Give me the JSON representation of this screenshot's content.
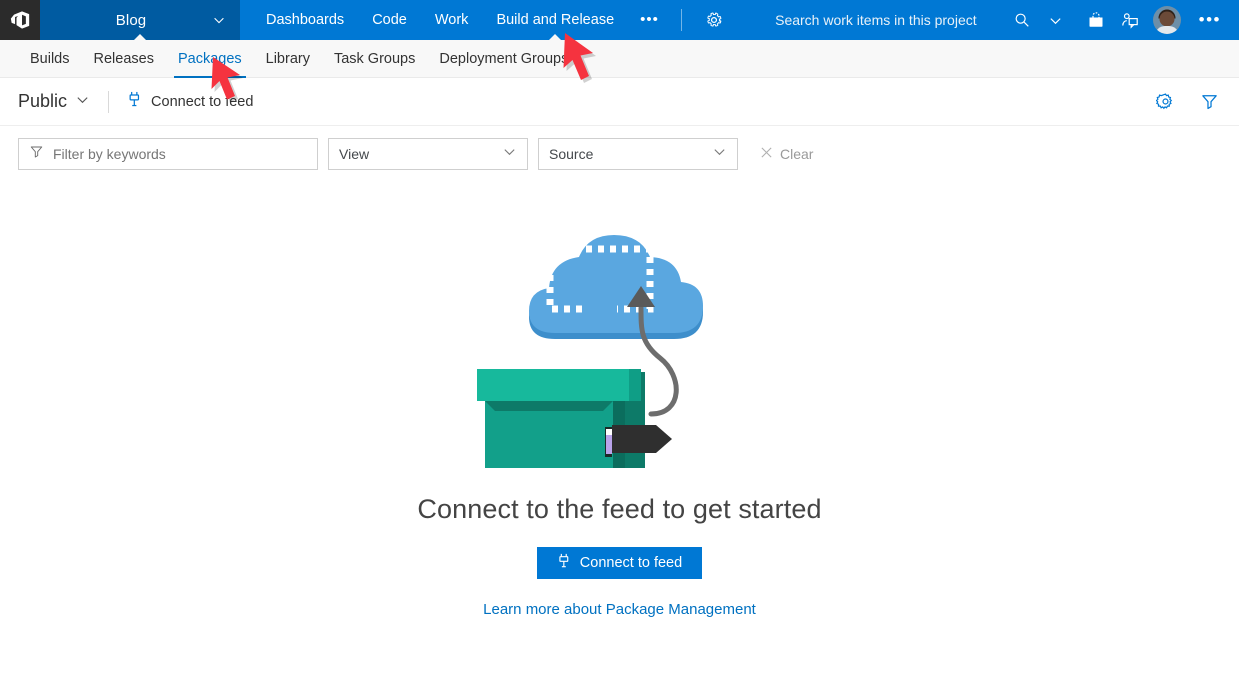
{
  "header": {
    "logo_icon": "azure-devops-logo-icon",
    "project_name": "Blog",
    "project_chevron_icon": "chevron-down-icon",
    "nav_items": [
      {
        "label": "Dashboards",
        "active": false
      },
      {
        "label": "Code",
        "active": false
      },
      {
        "label": "Work",
        "active": false
      },
      {
        "label": "Build and Release",
        "active": true
      }
    ],
    "overflow_label": "•••",
    "settings_icon": "gear-icon",
    "search_placeholder": "Search work items in this project",
    "search_icon": "search-icon",
    "search_chevron_icon": "chevron-down-icon",
    "marketplace_icon": "shopping-bag-icon",
    "help_icon": "user-feedback-icon",
    "avatar_icon": "avatar",
    "more_label": "•••"
  },
  "subnav": {
    "items": [
      {
        "label": "Builds",
        "active": false
      },
      {
        "label": "Releases",
        "active": false
      },
      {
        "label": "Packages",
        "active": true
      },
      {
        "label": "Library",
        "active": false
      },
      {
        "label": "Task Groups",
        "active": false
      },
      {
        "label": "Deployment Groups*",
        "active": false
      }
    ]
  },
  "feed_toolbar": {
    "feed_name": "Public",
    "feed_chevron_icon": "chevron-down-icon",
    "connect_label": "Connect to feed",
    "connect_icon": "plug-icon",
    "settings_icon": "gear-icon",
    "filter_icon": "funnel-icon"
  },
  "filters": {
    "keyword_placeholder": "Filter by keywords",
    "keyword_value": "",
    "keyword_icon": "funnel-icon",
    "view_label": "View",
    "view_options": [
      "View"
    ],
    "source_label": "Source",
    "source_options": [
      "Source"
    ],
    "clear_label": "Clear",
    "clear_icon": "close-icon",
    "dropdown_icon": "chevron-down-icon"
  },
  "empty_state": {
    "illustration_name": "cloud-upload-package-illustration",
    "title": "Connect to the feed to get started",
    "button_label": "Connect to feed",
    "button_icon": "plug-icon",
    "link_label": "Learn more about Package Management"
  },
  "annotations": [
    {
      "name": "red-arrow-build-and-release",
      "color": "#f5333f"
    },
    {
      "name": "red-arrow-packages",
      "color": "#f5333f"
    }
  ],
  "colors": {
    "header_blue": "#0078d4",
    "project_blue": "#005ba1",
    "accent_link": "#0071c1",
    "subnav_bg": "#f8f8f8",
    "cloud_blue": "#5aa7e0",
    "cloud_shadow": "#3d8ecb",
    "box_green": "#12a08a",
    "box_green_dark": "#0d7a68",
    "box_lid": "#17b99c",
    "cable_gray": "#6d6d6d",
    "plug_black": "#2f2f2f",
    "annotation_red": "#f5333f"
  }
}
